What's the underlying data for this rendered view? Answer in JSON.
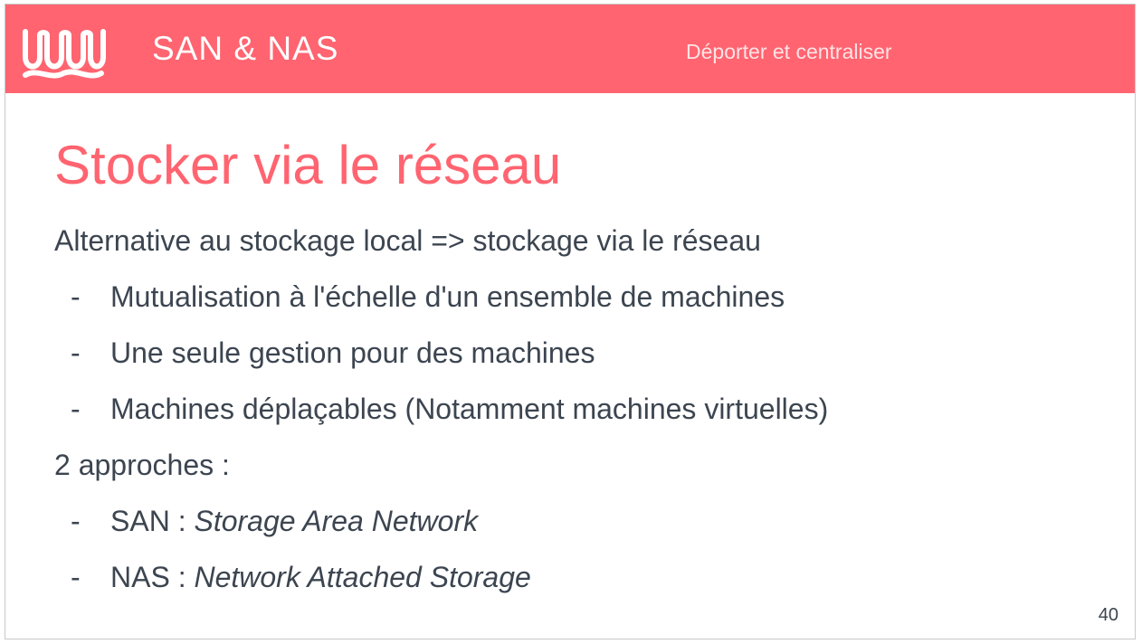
{
  "header": {
    "section_title": "SAN & NAS",
    "section_subtitle": "Déporter et centraliser",
    "logo": "wave-logo-icon",
    "background_color": "#ff6470"
  },
  "slide": {
    "title": "Stocker via le réseau",
    "intro": "Alternative au stockage local => stockage via le réseau",
    "bullets_1": [
      {
        "dash": "-",
        "text": "Mutualisation à l'échelle d'un ensemble de machines"
      },
      {
        "dash": "-",
        "text": "Une seule gestion pour des machines"
      },
      {
        "dash": "-",
        "text": "Machines déplaçables (Notamment machines virtuelles)"
      }
    ],
    "approaches_label": "2 approches :",
    "bullets_2": [
      {
        "dash": "-",
        "term": "SAN : ",
        "definition": "Storage Area Network"
      },
      {
        "dash": "-",
        "term": "NAS : ",
        "definition": "Network Attached Storage"
      }
    ],
    "page_number": "40"
  },
  "colors": {
    "accent": "#ff6470",
    "text": "#3c4550"
  }
}
